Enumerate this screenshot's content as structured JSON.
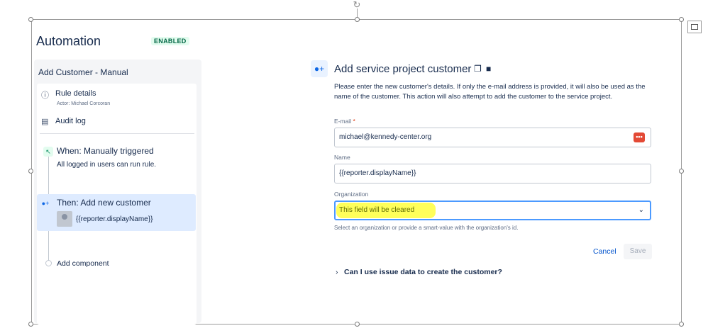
{
  "header": {
    "title": "Automation",
    "status_badge": "ENABLED"
  },
  "sidebar": {
    "rule_name": "Add Customer - Manual",
    "rule_details": {
      "label": "Rule details",
      "actor": "Actor: Michael Corcoran"
    },
    "audit_log": "Audit log",
    "trigger": {
      "title": "When: Manually triggered",
      "description": "All logged in users can run rule."
    },
    "action": {
      "title": "Then: Add new customer",
      "value": "{{reporter.displayName}}"
    },
    "add_component": "Add component"
  },
  "panel": {
    "title": "Add service project customer",
    "description": "Please enter the new customer's details. If only the e-mail address is provided, it will also be used as the name of the customer. This action will also attempt to add the customer to the service project.",
    "email": {
      "label": "E-mail",
      "required_mark": "*",
      "value": "michael@kennedy-center.org",
      "action_icon": "•••"
    },
    "name": {
      "label": "Name",
      "value": "{{reporter.displayName}}"
    },
    "organization": {
      "label": "Organization",
      "value": "This field will be cleared",
      "helper": "Select an organization or provide a smart-value with the organization's id."
    },
    "cancel_label": "Cancel",
    "save_label": "Save",
    "faq": "Can I use issue data to create the customer?"
  },
  "icons": {
    "copy": "copy-icon",
    "trash": "trash-icon",
    "chevron": "chevron-down-icon"
  }
}
